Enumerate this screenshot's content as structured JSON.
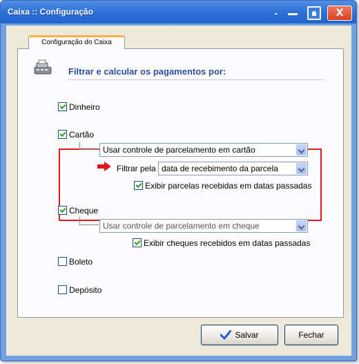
{
  "window": {
    "title": "Caixa :: Configuração",
    "controls": {
      "close_label": "X"
    }
  },
  "tab": {
    "label": "Configuração do Caixa"
  },
  "heading": {
    "text": "Filtrar e calcular os pagamentos por:"
  },
  "options": {
    "dinheiro": {
      "label": "Dinheiro",
      "checked": true
    },
    "cartao": {
      "label": "Cartão",
      "checked": true,
      "parcelamento_select": "Usar controle de parcelamento em cartão",
      "filtrar_label": "Filtrar pela",
      "filtrar_select": "data de recebimento da parcela",
      "exibir_label": "Exibir parcelas recebidas em datas passadas",
      "exibir_checked": true
    },
    "cheque": {
      "label": "Cheque",
      "checked": true,
      "parcelamento_select": "Usar controle de parcelamento em cheque",
      "exibir_label": "Exibir cheques recebidos em datas passadas",
      "exibir_checked": true
    },
    "boleto": {
      "label": "Boleto",
      "checked": false
    },
    "deposito": {
      "label": "Depósito",
      "checked": false
    }
  },
  "buttons": {
    "save": "Salvar",
    "cancel": "Fechar"
  },
  "colors": {
    "title_blue": "#2b6fd8",
    "heading_blue": "#2c4f9e",
    "highlight_red": "#e0141b"
  },
  "icons": [
    "cash-register-icon",
    "red-arrow-icon",
    "checkmark-icon",
    "close-icon"
  ]
}
